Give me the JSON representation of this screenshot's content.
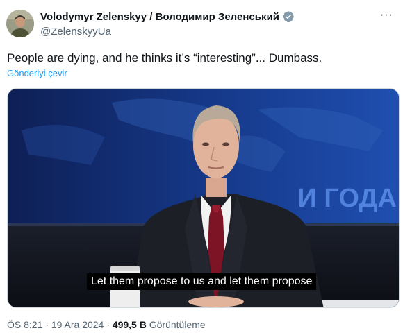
{
  "author": {
    "display_name": "Volodymyr Zelenskyy / Володимир Зеленський",
    "handle": "@ZelenskyyUa",
    "verified_icon": "verified-badge-icon",
    "avatar": "profile-photo"
  },
  "more_icon": "more-options-icon",
  "tweet": {
    "text": "People are dying, and he thinks it’s “interesting”... Dumbass.",
    "translate_link": "Gönderiyi çevir"
  },
  "media": {
    "subtitle": "Let them propose to us and let them propose",
    "backdrop_text": "И ГОДА"
  },
  "meta": {
    "time": "ÖS 8:21",
    "separator1": "·",
    "date": "19 Ara 2024",
    "separator2": "·",
    "views_count": "499,5 B",
    "views_label": "Görüntüleme"
  },
  "colors": {
    "link": "#1d9bf0",
    "verified": "#829aab",
    "secondary_text": "#536471",
    "primary_text": "#0f1419"
  }
}
